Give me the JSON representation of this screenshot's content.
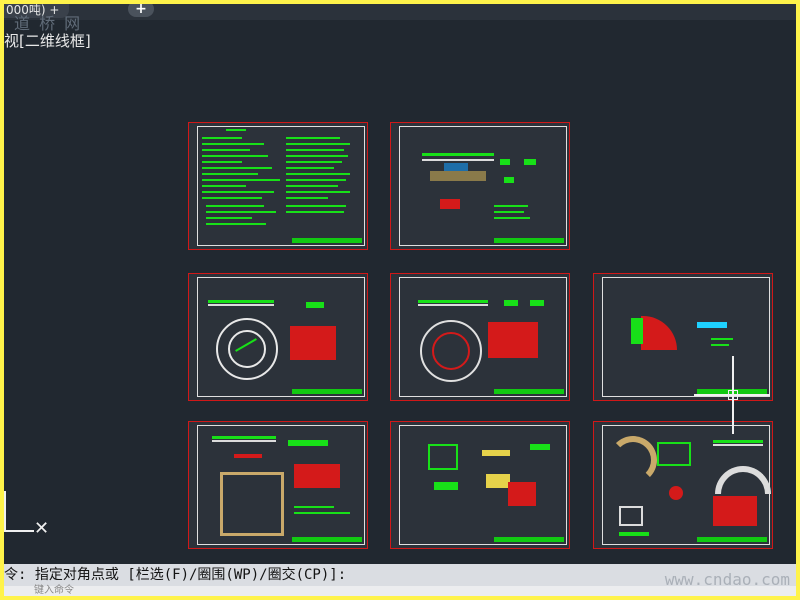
{
  "tab": {
    "title": "000吨) +",
    "add_glyph": "+"
  },
  "watermark_top": "道 桥 网",
  "viewport_label": "视[二维线框]",
  "ucs_icon": "ucs-axis-icon",
  "crosshair": "crosshair-icon",
  "command": {
    "prompt": "令: 指定对角点或 [栏选(F)/圈围(WP)/圈交(CP)]:",
    "input_hint": "键入命令"
  },
  "watermark_bottom": "www.cndao.com",
  "colors": {
    "background": "#212830",
    "frame": "#fff34a",
    "sheet_border": "#d01818",
    "linework": "#18e018"
  },
  "sheets": [
    {
      "id": "sheet-1",
      "kind": "general-notes"
    },
    {
      "id": "sheet-2",
      "kind": "section-details"
    },
    {
      "id": "sheet-3",
      "kind": "circular-plan"
    },
    {
      "id": "sheet-4",
      "kind": "circular-plan"
    },
    {
      "id": "sheet-5",
      "kind": "partial-plan"
    },
    {
      "id": "sheet-6",
      "kind": "square-plan"
    },
    {
      "id": "sheet-7",
      "kind": "details"
    },
    {
      "id": "sheet-8",
      "kind": "arc-details"
    }
  ]
}
